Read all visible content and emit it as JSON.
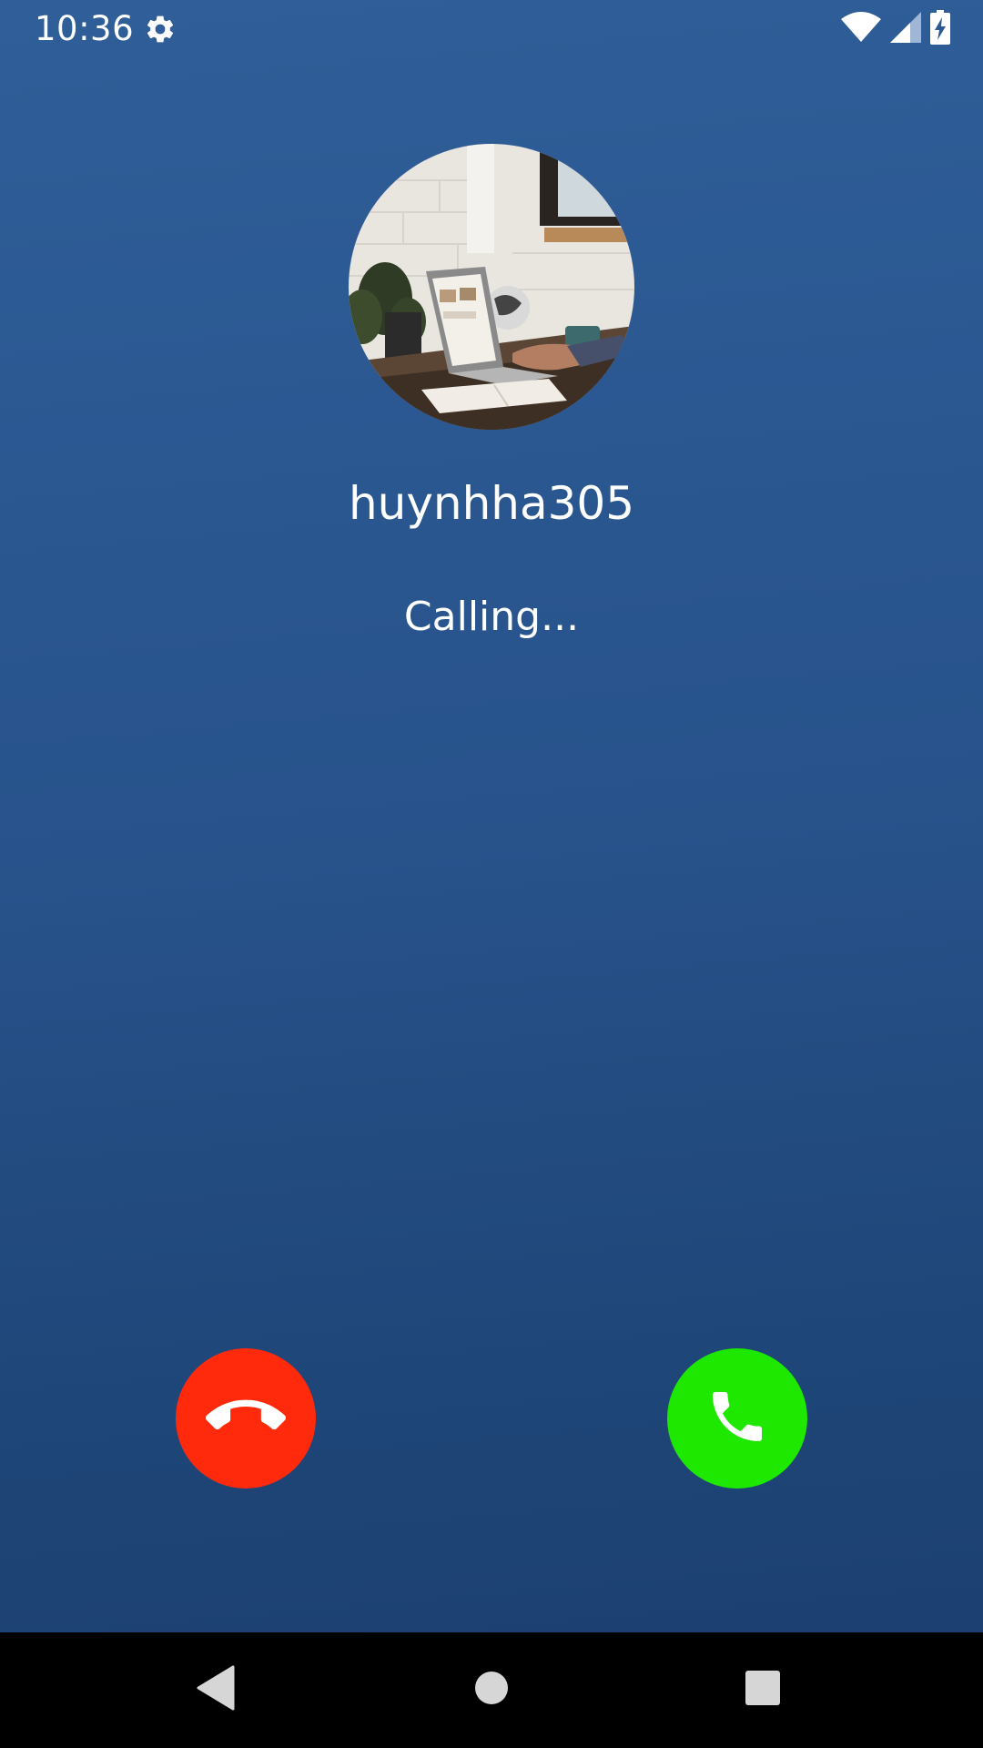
{
  "status_bar": {
    "time": "10:36",
    "icons": [
      "settings-gear-icon",
      "wifi-icon",
      "cell-signal-icon",
      "battery-charging-icon"
    ]
  },
  "caller": {
    "name": "huynhha305",
    "status": "Calling..."
  },
  "actions": {
    "decline": {
      "icon": "hang-up-icon",
      "color": "#ff2a0c"
    },
    "accept": {
      "icon": "phone-icon",
      "color": "#1ee800"
    }
  },
  "nav": {
    "items": [
      "back-icon",
      "home-icon",
      "recents-icon"
    ]
  },
  "colors": {
    "background_top": "#2f5e98",
    "background_bottom": "#1b3d6e",
    "nav_bar": "#000000",
    "text": "#ffffff"
  }
}
